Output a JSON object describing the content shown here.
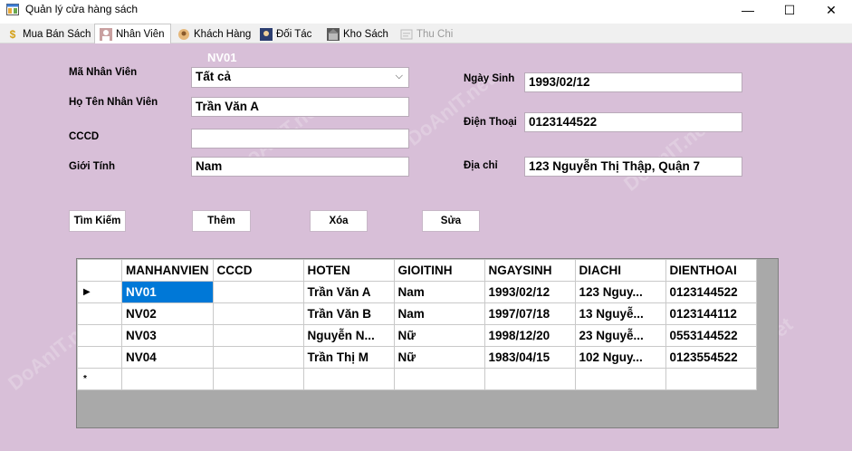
{
  "window": {
    "title": "Quản lý cửa hàng sách",
    "minimize": "—",
    "maximize": "☐",
    "close": "✕"
  },
  "tabs": [
    {
      "label": "Mua Bán Sách",
      "icon": "dollar-icon"
    },
    {
      "label": "Nhân Viên",
      "icon": "person-icon"
    },
    {
      "label": "Khách Hàng",
      "icon": "customer-icon"
    },
    {
      "label": "Đối Tác",
      "icon": "partner-icon"
    },
    {
      "label": "Kho Sách",
      "icon": "warehouse-icon"
    },
    {
      "label": "Thu Chi",
      "icon": "finance-icon"
    }
  ],
  "form": {
    "selected_code": "NV01",
    "ma_nv_label": "Mã Nhân Viên",
    "ma_nv_value": "Tất cả",
    "ho_ten_label": "Họ Tên Nhân Viên",
    "ho_ten_value": "Trần Văn A",
    "cccd_label": "CCCD",
    "cccd_value": "",
    "gioi_tinh_label": "Giới Tính",
    "gioi_tinh_value": "Nam",
    "ngay_sinh_label": "Ngày Sinh",
    "ngay_sinh_value": "1993/02/12",
    "dien_thoai_label": "Điện Thoại",
    "dien_thoai_value": "0123144522",
    "dia_chi_label": "Địa chỉ",
    "dia_chi_value": "123 Nguyễn Thị Thập, Quận 7"
  },
  "buttons": {
    "search": "Tìm Kiếm",
    "add": "Thêm",
    "delete": "Xóa",
    "edit": "Sửa"
  },
  "grid": {
    "columns": [
      "MANHANVIEN",
      "CCCD",
      "HOTEN",
      "GIOITINH",
      "NGAYSINH",
      "DIACHI",
      "DIENTHOAI"
    ],
    "rows": [
      {
        "marker": "▶",
        "cells": [
          "NV01",
          "",
          "Trần Văn A",
          "Nam",
          "1993/02/12",
          "123 Nguy...",
          "0123144522"
        ]
      },
      {
        "marker": "",
        "cells": [
          "NV02",
          "",
          "Trần Văn B",
          "Nam",
          "1997/07/18",
          "13 Nguyễ...",
          "0123144112"
        ]
      },
      {
        "marker": "",
        "cells": [
          "NV03",
          "",
          "Nguyễn N...",
          "Nữ",
          "1998/12/20",
          "23 Nguyễ...",
          "0553144522"
        ]
      },
      {
        "marker": "",
        "cells": [
          "NV04",
          "",
          "Trần Thị M",
          "Nữ",
          "1983/04/15",
          "102 Nguy...",
          "0123554522"
        ]
      },
      {
        "marker": "*",
        "cells": [
          "",
          "",
          "",
          "",
          "",
          "",
          ""
        ]
      }
    ]
  },
  "watermark": "DoAnIT.net",
  "colors": {
    "panel": "#d8bfd8",
    "selection": "#0078d7",
    "grid_bg": "#a9a9a9"
  }
}
